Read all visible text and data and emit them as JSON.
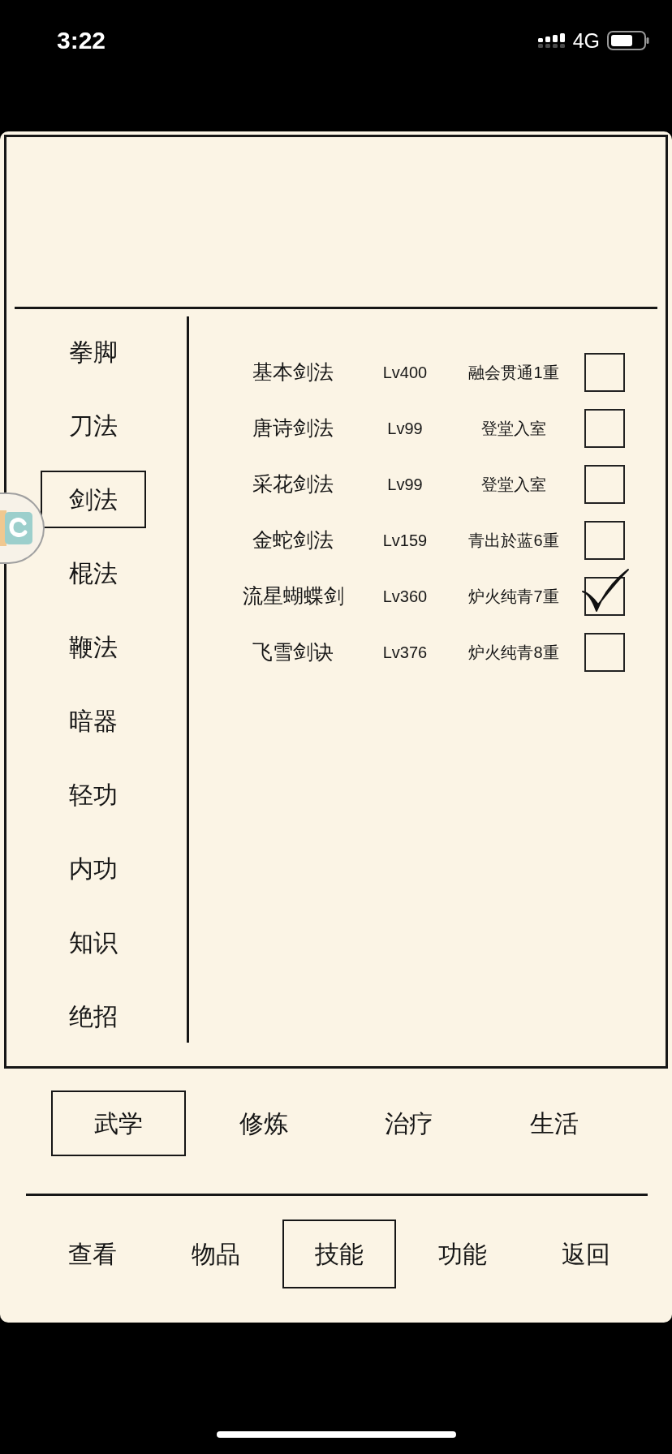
{
  "status_bar": {
    "time": "3:22",
    "network": "4G"
  },
  "categories": [
    {
      "label": "拳脚",
      "selected": false
    },
    {
      "label": "刀法",
      "selected": false
    },
    {
      "label": "剑法",
      "selected": true
    },
    {
      "label": "棍法",
      "selected": false
    },
    {
      "label": "鞭法",
      "selected": false
    },
    {
      "label": "暗器",
      "selected": false
    },
    {
      "label": "轻功",
      "selected": false
    },
    {
      "label": "内功",
      "selected": false
    },
    {
      "label": "知识",
      "selected": false
    },
    {
      "label": "绝招",
      "selected": false
    }
  ],
  "skills": [
    {
      "name": "基本剑法",
      "lv_text": "Lv400",
      "stage": "融会贯通1重",
      "checked": false
    },
    {
      "name": "唐诗剑法",
      "lv_text": "Lv99",
      "stage": "登堂入室",
      "checked": false
    },
    {
      "name": "采花剑法",
      "lv_text": "Lv99",
      "stage": "登堂入室",
      "checked": false
    },
    {
      "name": "金蛇剑法",
      "lv_text": "Lv159",
      "stage": "青出於蓝6重",
      "checked": false
    },
    {
      "name": "流星蝴蝶剑",
      "lv_text": "Lv360",
      "stage": "炉火纯青7重",
      "checked": true
    },
    {
      "name": "飞雪剑诀",
      "lv_text": "Lv376",
      "stage": "炉火纯青8重",
      "checked": false
    }
  ],
  "sub_tabs": [
    {
      "label": "武学",
      "selected": true
    },
    {
      "label": "修炼",
      "selected": false
    },
    {
      "label": "治疗",
      "selected": false
    },
    {
      "label": "生活",
      "selected": false
    }
  ],
  "nav": [
    {
      "label": "查看",
      "selected": false
    },
    {
      "label": "物品",
      "selected": false
    },
    {
      "label": "技能",
      "selected": true
    },
    {
      "label": "功能",
      "selected": false
    },
    {
      "label": "返回",
      "selected": false
    }
  ]
}
